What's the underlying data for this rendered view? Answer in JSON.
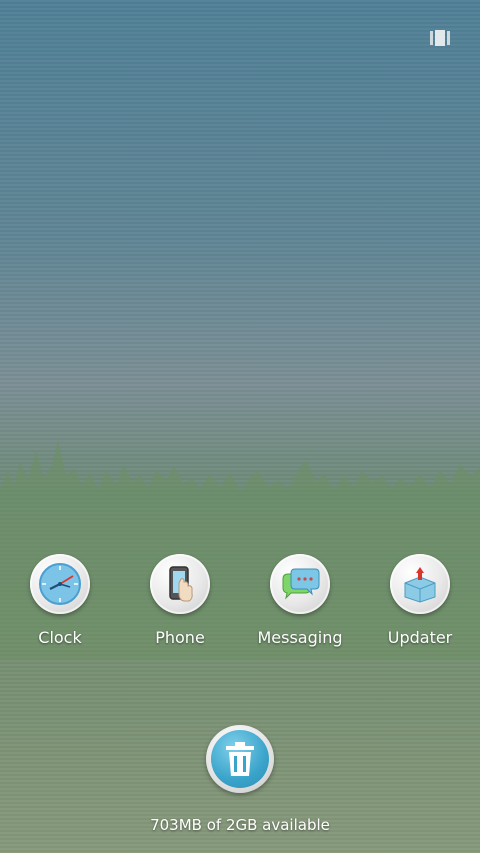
{
  "recents": {
    "icon": "recent-apps-icon"
  },
  "apps": [
    {
      "label": "Clock",
      "icon": "clock-icon"
    },
    {
      "label": "Phone",
      "icon": "phone-icon"
    },
    {
      "label": "Messaging",
      "icon": "messaging-icon"
    },
    {
      "label": "Updater",
      "icon": "updater-icon"
    }
  ],
  "clear_all": {
    "icon": "trash-icon"
  },
  "memory": {
    "text": "703MB of 2GB available"
  },
  "colors": {
    "accent": "#3ba4cb",
    "label": "#ffffff"
  }
}
